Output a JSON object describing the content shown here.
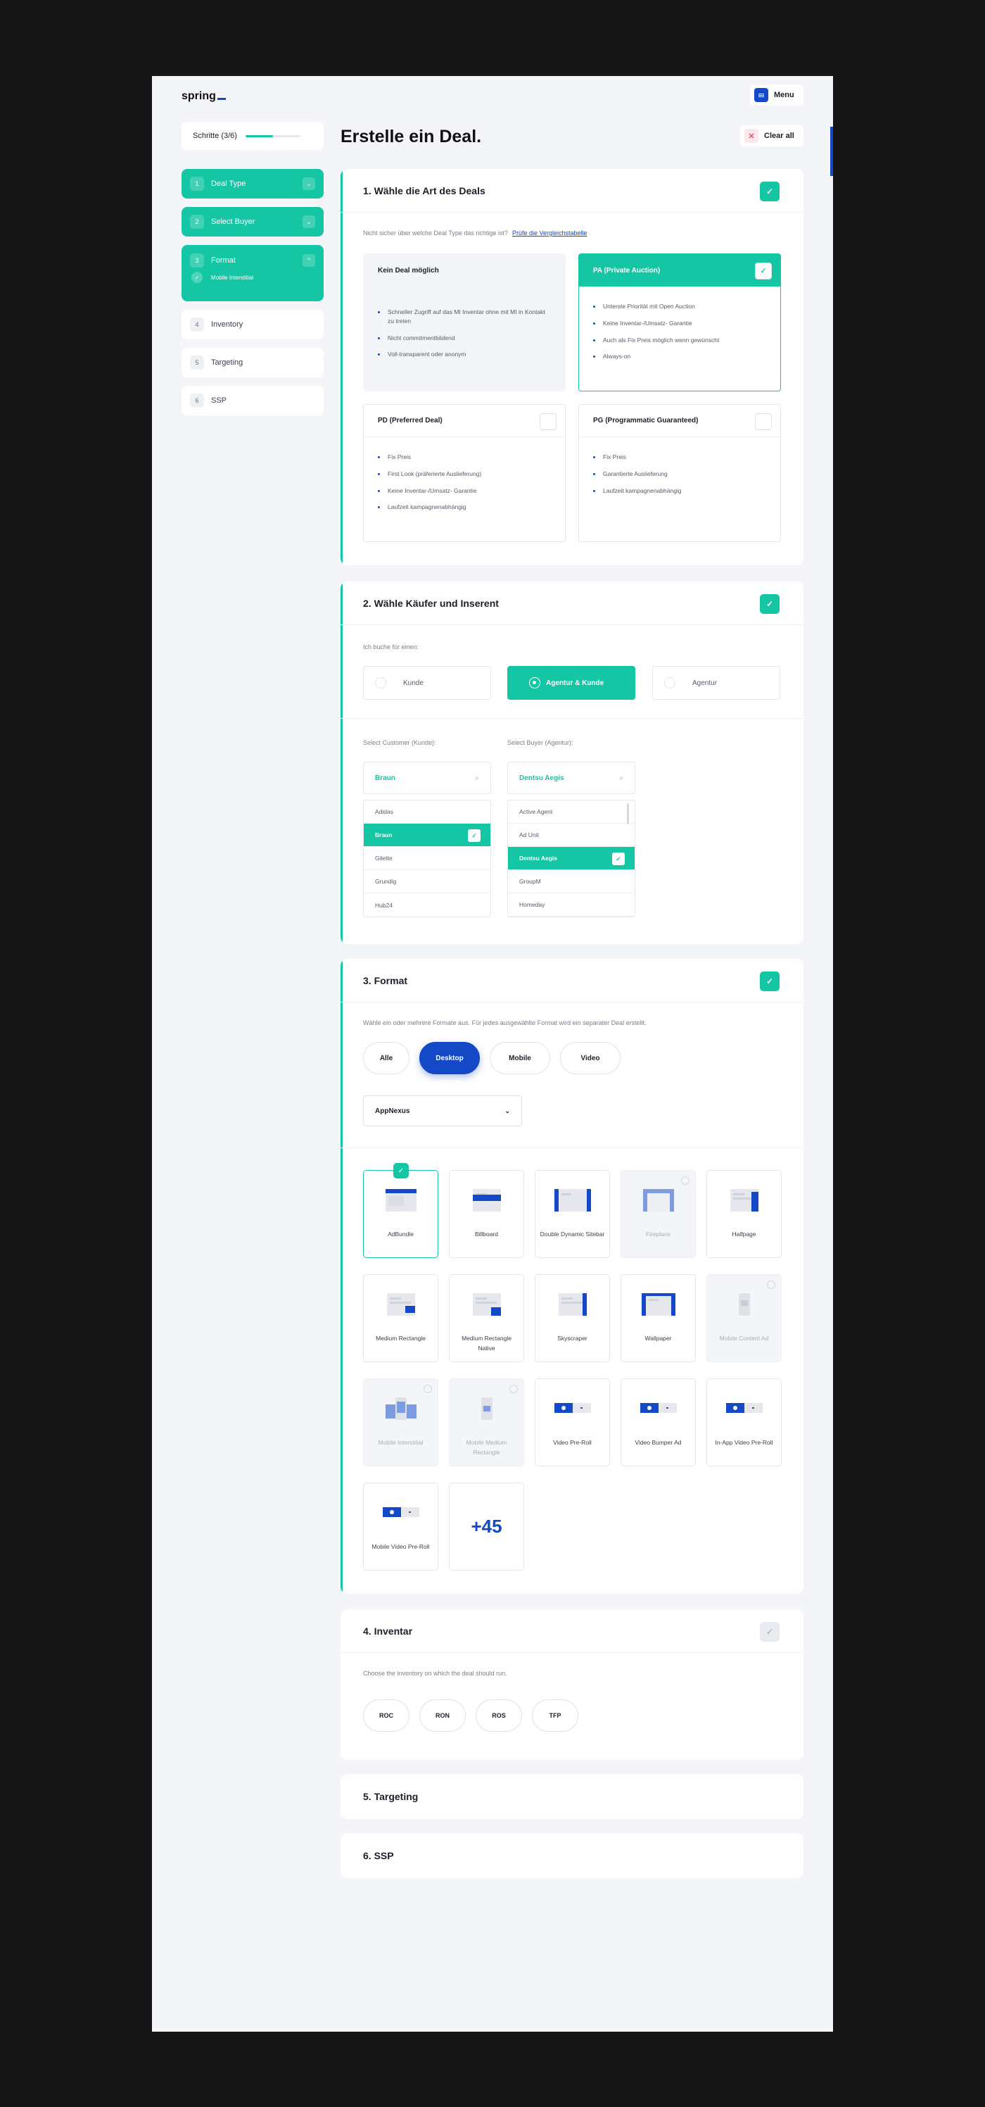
{
  "brand": {
    "logo": "spring"
  },
  "header": {
    "menu_label": "Menu",
    "title": "Erstelle ein Deal.",
    "clear_label": "Clear all"
  },
  "progress": {
    "label": "Schritte (3/6)",
    "completed": 3,
    "total": 6
  },
  "nav": {
    "items": [
      {
        "num": "1",
        "label": "Deal Type",
        "state": "done"
      },
      {
        "num": "2",
        "label": "Select Buyer",
        "state": "done"
      },
      {
        "num": "3",
        "label": "Format",
        "state": "done",
        "sub": "Mobile Interstitial"
      },
      {
        "num": "4",
        "label": "Inventory",
        "state": "open"
      },
      {
        "num": "5",
        "label": "Targeting",
        "state": "open"
      },
      {
        "num": "6",
        "label": "SSP",
        "state": "open"
      }
    ]
  },
  "section1": {
    "title": "1. Wähle die Art des Deals",
    "hint": "Nicht sicher über welche Deal Type das richtige ist?",
    "hint_link": "Prüfe die Vergleichstabelle",
    "deals": [
      {
        "title": "Kein Deal möglich",
        "bullets": [
          "Schneller Zugriff auf das MI Inventar ohne mit MI in Kontakt zu treten",
          "Nicht commitmentbildend",
          "Voll-transparent oder anonym"
        ]
      },
      {
        "title": "PA (Private Auction)",
        "bullets": [
          "Unterste Priorität mit Open Auction",
          "Keine Inventar-/Umsatz- Garantie",
          "Auch als Fix Preis möglich wenn gewünscht",
          "Always-on"
        ]
      },
      {
        "title": "PD (Preferred Deal)",
        "bullets": [
          "Fix Preis",
          "First Look (präferierte Auslieferung)",
          "Keine Inventar-/Umsatz- Garantie",
          "Laufzeit kampagnenabhängig"
        ]
      },
      {
        "title": "PG (Programmatic Guaranteed)",
        "bullets": [
          "Fix Preis",
          "Garantierte Auslieferung",
          "Laufzeit kampagnenabhängig"
        ]
      }
    ]
  },
  "section2": {
    "title": "2. Wähle Käufer und Inserent",
    "hint": "Ich buche für einen:",
    "options": [
      "Kunde",
      "Agentur & Kunde",
      "Agentur"
    ],
    "customer_label": "Select Customer (Kunde):",
    "customer_value": "Braun",
    "customers": [
      "Adidas",
      "Braun",
      "Gilette",
      "Grundig",
      "Hub24"
    ],
    "buyer_label": "Select Buyer (Agentur):",
    "buyer_value": "Dentsu Aegis",
    "buyers": [
      "Active Agent",
      "Ad Unit",
      "Dentsu Aegis",
      "GroupM",
      "Homeday"
    ]
  },
  "section3": {
    "title": "3. Format",
    "hint": "Wähle ein oder mehrere Formate aus. Für jedes ausgewählte Format wird ein separater Deal erstellt.",
    "filters": [
      "Alle",
      "Desktop",
      "Mobile",
      "Video"
    ],
    "platform": "AppNexus",
    "formats": [
      {
        "label": "AdBundle"
      },
      {
        "label": "Billboard"
      },
      {
        "label": "Double Dynamic Sitebar"
      },
      {
        "label": "Fireplace"
      },
      {
        "label": "Halfpage"
      },
      {
        "label": "Medium Rectangle"
      },
      {
        "label": "Medium Rectangle Native"
      },
      {
        "label": "Skyscraper"
      },
      {
        "label": "Wallpaper"
      },
      {
        "label": "Mobile Content Ad"
      },
      {
        "label": "Mobile Interstitial"
      },
      {
        "label": "Mobile Medium Rectangle"
      },
      {
        "label": "Video Pre-Roll"
      },
      {
        "label": "Video Bumper Ad"
      },
      {
        "label": "In-App Video Pre-Roll"
      },
      {
        "label": "Mobile Video Pre-Roll"
      }
    ],
    "more": "+45"
  },
  "section4": {
    "title": "4. Inventar",
    "hint": "Choose the inventory on which the deal should run.",
    "options": [
      "ROC",
      "RON",
      "ROS",
      "TFP"
    ]
  },
  "section5": {
    "title": "5. Targeting"
  },
  "section6": {
    "title": "6. SSP"
  },
  "icons": {
    "check": "check-icon",
    "close": "close-icon",
    "chevron": "chevron-icon",
    "search": "search-icon",
    "menu": "menu-icon",
    "plus": "plus-icon"
  },
  "colors": {
    "accent": "#14c6a4",
    "brand": "#1348c7",
    "danger": "#e2576b"
  }
}
